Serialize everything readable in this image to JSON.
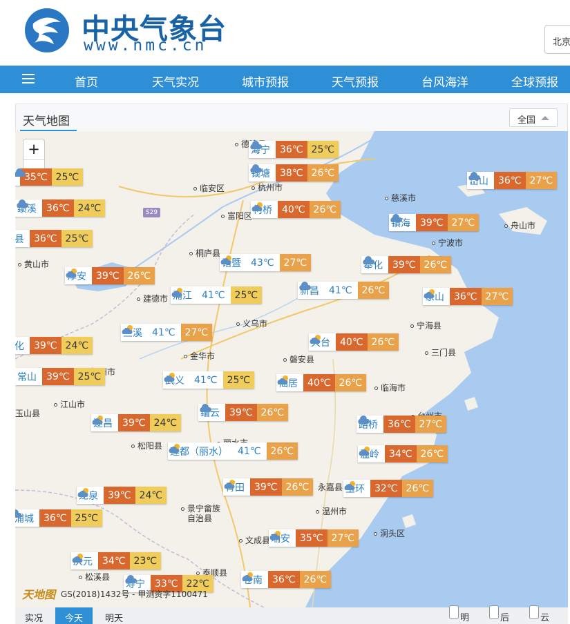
{
  "site": {
    "name_cn": "中央气象台",
    "domain": "www.nmc.cn"
  },
  "city_search": {
    "value": "北京"
  },
  "nav": {
    "items": [
      "首页",
      "天气实况",
      "城市预报",
      "天气预报",
      "台风海洋",
      "全球预报"
    ]
  },
  "panel": {
    "title": "天气地图",
    "scope": "全国"
  },
  "map": {
    "zoom_in": "+",
    "zoom_out": "−",
    "road_badge": "S29",
    "cities": [
      "德清县",
      "临安区",
      "杭州市",
      "富阳区",
      "桐庐县",
      "建德市",
      "黄山市",
      "义乌市",
      "金华市",
      "磐安县",
      "衢州市",
      "江山市",
      "玉山县",
      "松阳县",
      "丽水市",
      "景宁畲族自治县",
      "文成县",
      "泰顺县",
      "松溪县",
      "永嘉县",
      "温州市",
      "洞头区",
      "台州市",
      "临海市",
      "三门县",
      "宁海县",
      "宁波市",
      "舟山市",
      "慈溪市"
    ],
    "cards": [
      {
        "name": "海宁",
        "max": "36℃",
        "min": "25℃",
        "icon": "cloud-rain-icon"
      },
      {
        "name": "钱塘",
        "max": "38℃",
        "min": "26℃",
        "icon": "cloud-rain-icon"
      },
      {
        "name": "岱山",
        "max": "36℃",
        "min": "27℃",
        "icon": "cloud-rain-icon"
      },
      {
        "name": "",
        "max": "35℃",
        "min": "25℃",
        "icon": "cloud-rain-icon"
      },
      {
        "name": "绩溪",
        "max": "36℃",
        "min": "24℃",
        "icon": "cloud-rain-icon"
      },
      {
        "name": "柯桥",
        "max": "40℃",
        "min": "26℃",
        "icon": "sun-cloud-icon"
      },
      {
        "name": "镇海",
        "max": "39℃",
        "min": "27℃",
        "icon": "cloud-rain-icon"
      },
      {
        "name": "县",
        "max": "36℃",
        "min": "25℃",
        "icon": "cloud-rain-icon"
      },
      {
        "name": "诸暨",
        "max": "43℃",
        "min": "27℃",
        "icon": "sun-cloud-icon"
      },
      {
        "name": "奉化",
        "max": "39℃",
        "min": "26℃",
        "icon": "cloud-rain-icon"
      },
      {
        "name": "淳安",
        "max": "39℃",
        "min": "26℃",
        "icon": "sun-cloud-icon"
      },
      {
        "name": "浦江",
        "max": "41℃",
        "min": "25℃",
        "icon": "sun-cloud-icon"
      },
      {
        "name": "新昌",
        "max": "41℃",
        "min": "26℃",
        "icon": "cloud-rain-icon"
      },
      {
        "name": "象山",
        "max": "36℃",
        "min": "27℃",
        "icon": "sun-cloud-icon"
      },
      {
        "name": "兰溪",
        "max": "41℃",
        "min": "27℃",
        "icon": "sun-cloud-icon"
      },
      {
        "name": "天台",
        "max": "40℃",
        "min": "26℃",
        "icon": "sun-cloud-icon"
      },
      {
        "name": "化",
        "max": "39℃",
        "min": "24℃",
        "icon": "none"
      },
      {
        "name": "常山",
        "max": "39℃",
        "min": "25℃",
        "icon": "none"
      },
      {
        "name": "武义",
        "max": "41℃",
        "min": "25℃",
        "icon": "sun-cloud-icon"
      },
      {
        "name": "仙居",
        "max": "40℃",
        "min": "26℃",
        "icon": "sun-cloud-icon"
      },
      {
        "name": "缙云",
        "max": "39℃",
        "min": "26℃",
        "icon": "cloud-rain-icon"
      },
      {
        "name": "遂昌",
        "max": "39℃",
        "min": "24℃",
        "icon": "sun-cloud-icon"
      },
      {
        "name": "路桥",
        "max": "36℃",
        "min": "27℃",
        "icon": "cloud-rain-icon"
      },
      {
        "name": "莲都（丽水）",
        "max": "41℃",
        "min": "26℃",
        "icon": "sun-cloud-icon"
      },
      {
        "name": "温岭",
        "max": "34℃",
        "min": "26℃",
        "icon": "sun-cloud-icon"
      },
      {
        "name": "青田",
        "max": "39℃",
        "min": "26℃",
        "icon": "sun-cloud-icon"
      },
      {
        "name": "玉环",
        "max": "32℃",
        "min": "26℃",
        "icon": "sun-cloud-icon"
      },
      {
        "name": "龙泉",
        "max": "39℃",
        "min": "24℃",
        "icon": "sun-cloud-icon"
      },
      {
        "name": "浦城",
        "max": "36℃",
        "min": "25℃",
        "icon": "cloud-rain-icon"
      },
      {
        "name": "瑞安",
        "max": "35℃",
        "min": "27℃",
        "icon": "sun-cloud-icon"
      },
      {
        "name": "庆元",
        "max": "34℃",
        "min": "23℃",
        "icon": "sun-cloud-icon"
      },
      {
        "name": "苍南",
        "max": "36℃",
        "min": "26℃",
        "icon": "sun-cloud-icon"
      },
      {
        "name": "寿宁",
        "max": "33℃",
        "min": "22℃",
        "icon": "cloud-rain-icon"
      }
    ],
    "credit": "GS(2018)1432号 - 甲测资字1100471",
    "brand": "天地图"
  },
  "tabs": [
    "实况",
    "今天",
    "明天"
  ],
  "timeline": {
    "labels": [
      "明",
      "后",
      "云"
    ]
  }
}
